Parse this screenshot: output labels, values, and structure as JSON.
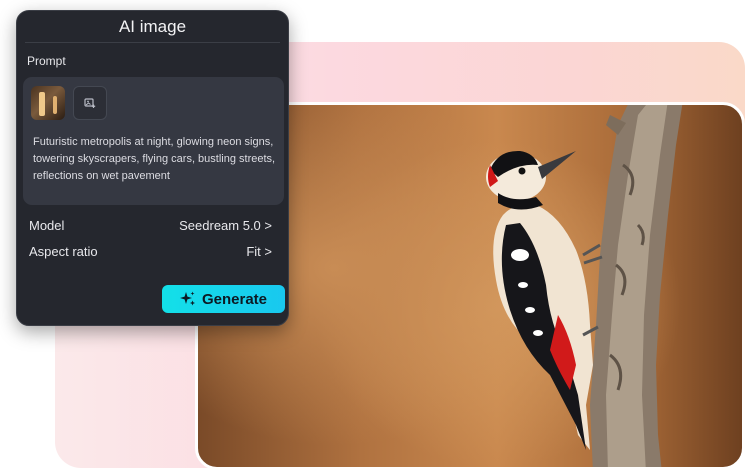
{
  "panel": {
    "title": "AI image",
    "prompt_label": "Prompt",
    "prompt_text": "Futuristic metropolis at night, glowing neon signs, towering skyscrapers, flying cars, bustling streets, reflections on wet pavement",
    "model_label": "Model",
    "model_value": "Seedream 5.0 >",
    "aspect_label": "Aspect ratio",
    "aspect_value": "Fit >",
    "generate_label": "Generate"
  },
  "icons": {
    "thumbnail": "reference-image-thumbnail",
    "add_image": "add-image-icon",
    "generate": "sparkle-icon"
  },
  "colors": {
    "panel_bg": "#25272e",
    "prompt_box_bg": "#353842",
    "generate_accent": "#13e0e8",
    "backdrop_pink": "#fcd9e0"
  }
}
